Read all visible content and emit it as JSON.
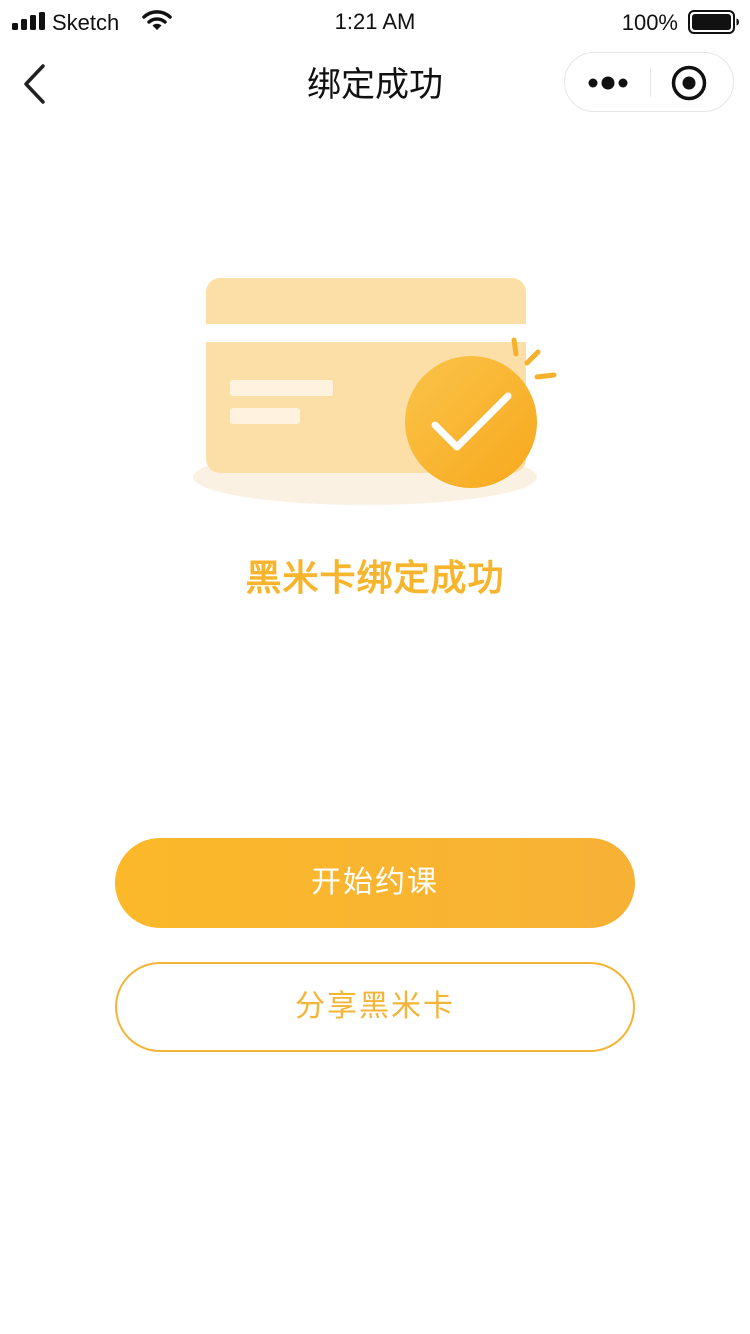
{
  "status_bar": {
    "carrier": "Sketch",
    "time": "1:21 AM",
    "battery": "100%",
    "icons": [
      "signal-icon",
      "wifi-icon",
      "battery-icon"
    ]
  },
  "nav": {
    "title": "绑定成功",
    "icons": [
      "back-icon",
      "more-icon",
      "close-icon"
    ]
  },
  "illustration": {
    "icons": [
      "card-icon",
      "check-icon"
    ],
    "colors": {
      "card": "#fcdfa6",
      "card_stripe": "#ffffff",
      "card_lines": "#fff3e0",
      "shadow": "#fbf1e3",
      "badge_start": "#fbc44a",
      "badge_end": "#f7a81c",
      "sparkle": "#f6b12a"
    }
  },
  "message": "黑米卡绑定成功",
  "buttons": {
    "primary": "开始约课",
    "secondary": "分享黑米卡"
  },
  "colors": {
    "accent": "#f7b52d",
    "primary_button": "#fbb829",
    "secondary_border": "#f4b437"
  }
}
